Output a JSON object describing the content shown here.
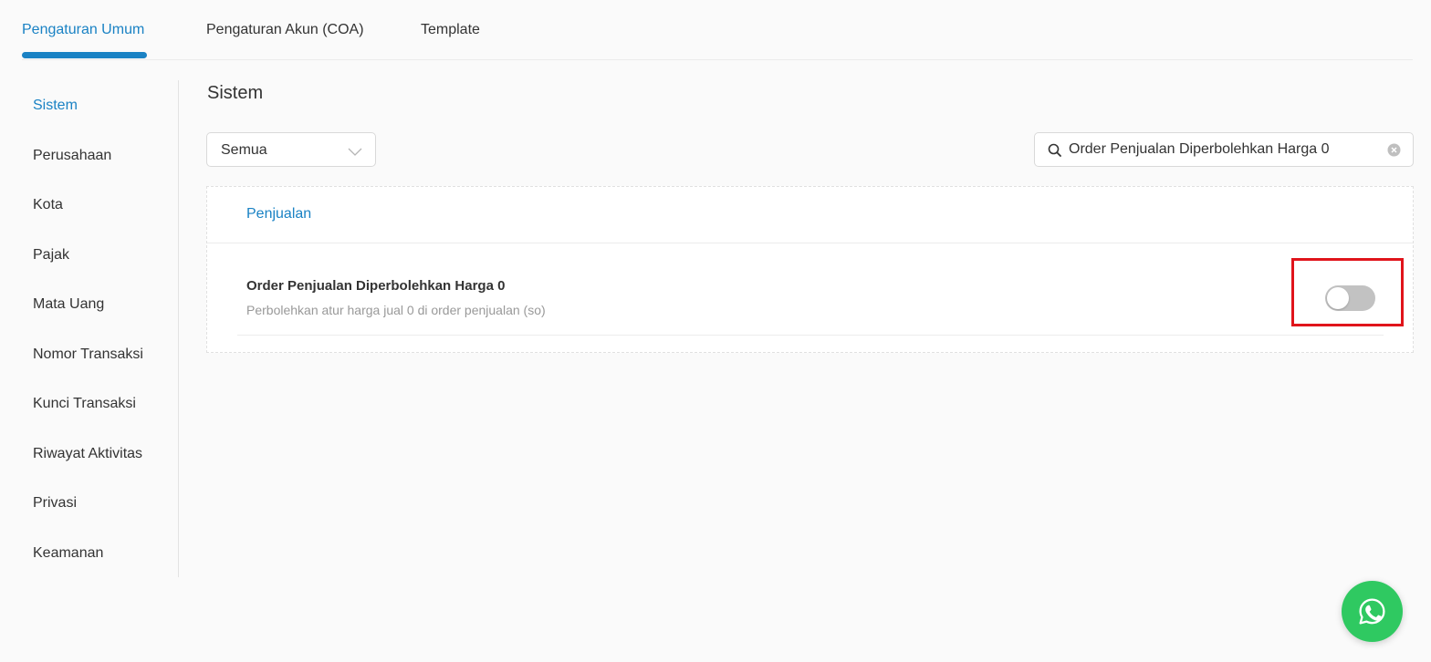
{
  "tabs": [
    {
      "label": "Pengaturan Umum",
      "active": true
    },
    {
      "label": "Pengaturan Akun (COA)",
      "active": false
    },
    {
      "label": "Template",
      "active": false
    }
  ],
  "sidebar": {
    "items": [
      {
        "label": "Sistem",
        "active": true
      },
      {
        "label": "Perusahaan"
      },
      {
        "label": "Kota"
      },
      {
        "label": "Pajak"
      },
      {
        "label": "Mata Uang"
      },
      {
        "label": "Nomor Transaksi"
      },
      {
        "label": "Kunci Transaksi"
      },
      {
        "label": "Riwayat Aktivitas"
      },
      {
        "label": "Privasi"
      },
      {
        "label": "Keamanan"
      }
    ]
  },
  "main": {
    "title": "Sistem",
    "filter": {
      "selected": "Semua"
    },
    "search": {
      "value": "Order Penjualan Diperbolehkan Harga 0"
    },
    "section": {
      "label": "Penjualan",
      "setting": {
        "title": "Order Penjualan Diperbolehkan Harga 0",
        "description": "Perbolehkan atur harga jual 0 di order penjualan (so)",
        "enabled": false
      }
    }
  },
  "colors": {
    "accent": "#1a82c4",
    "highlight": "#e0141b",
    "whatsapp": "#2fc961",
    "toggle_off": "#c2c2c2"
  },
  "icons": {
    "filter_chevron": "chevron-down-icon",
    "search": "search-icon",
    "clear": "clear-icon",
    "chat": "whatsapp-icon"
  }
}
